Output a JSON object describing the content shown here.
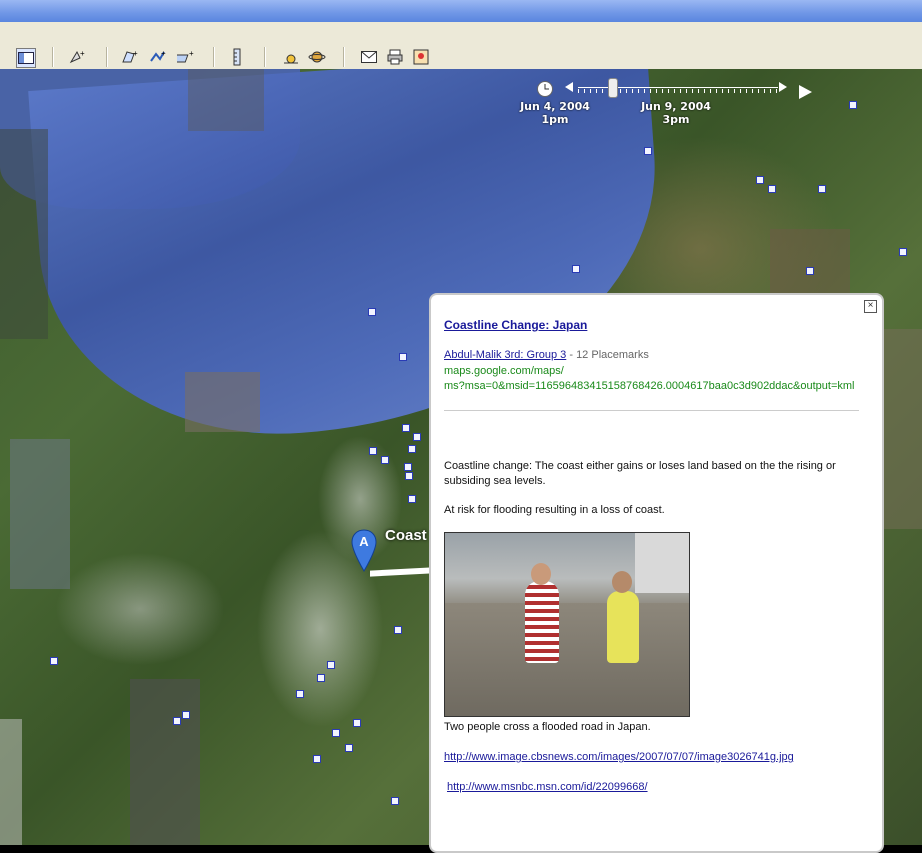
{
  "toolbar": {
    "icons": [
      "sidebar-toggle-icon",
      "placemark-icon",
      "polygon-icon",
      "path-icon",
      "image-overlay-icon",
      "ruler-icon",
      "sunlight-icon",
      "planets-icon",
      "email-icon",
      "print-icon",
      "maps-icon"
    ]
  },
  "timeline": {
    "start_date": "Jun  4, 2004",
    "start_time": "1pm",
    "end_date": "Jun  9, 2004",
    "end_time": "3pm"
  },
  "map": {
    "marker_letter": "A",
    "marker_label": "Coast"
  },
  "balloon": {
    "title": "Coastline Change: Japan",
    "author_link": "Abdul-Malik 3rd: Group 3",
    "placemark_count": "- 12 Placemarks",
    "source_url_line1": "maps.google.com/maps/",
    "source_url_line2": "ms?msa=0&msid=116596483415158768426.0004617baa0c3d902ddac&output=kml",
    "description_1": "Coastline change: The coast either gains or loses land based on the the rising or subsiding sea levels.",
    "description_2": "At risk for flooding resulting in a loss of coast.",
    "photo_caption": "Two people cross a flooded road in Japan.",
    "link_1": "http://www.image.cbsnews.com/images/2007/07/07/image3026741g.jpg",
    "link_2": "http://www.msnbc.msn.com/id/22099668/"
  }
}
